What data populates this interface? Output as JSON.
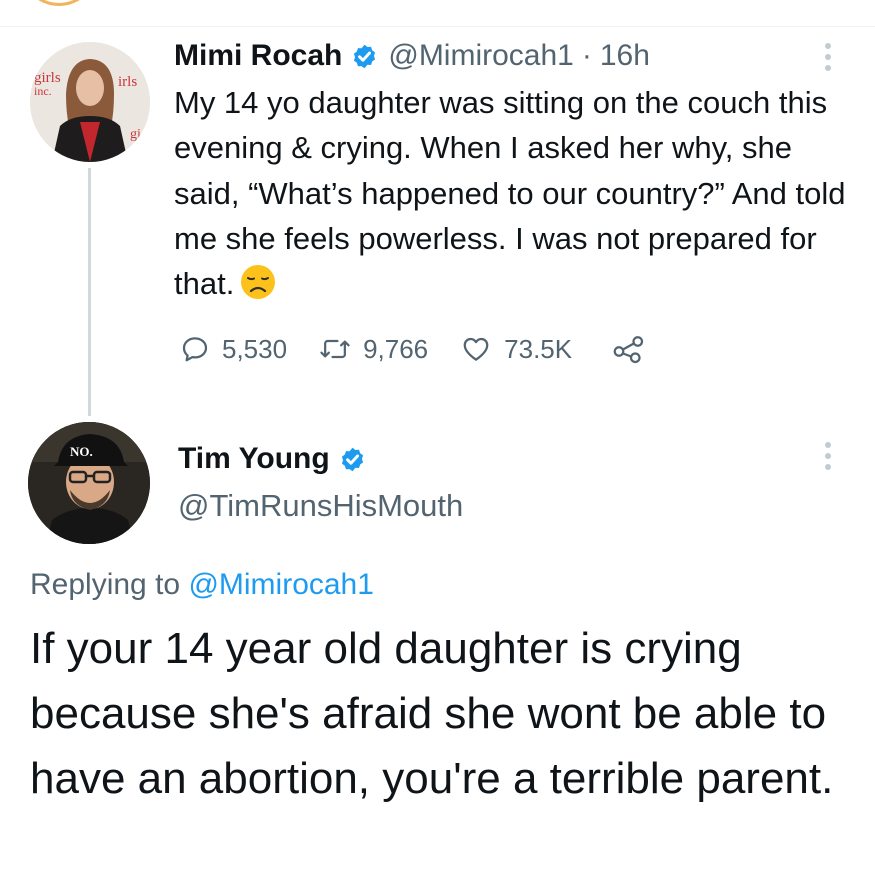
{
  "tweet1": {
    "display_name": "Mimi Rocah",
    "handle": "@Mimirocah1",
    "separator": "·",
    "time": "16h",
    "text": "My 14 yo daughter was sitting on the couch this evening & crying. When I asked her why, she said, “What’s happened to our country?” And told me she feels powerless. I was not prepared for that.",
    "emoji": "disappointed-face",
    "stats": {
      "replies": "5,530",
      "retweets": "9,766",
      "likes": "73.5K"
    }
  },
  "tweet2": {
    "display_name": "Tim Young",
    "handle": "@TimRunsHisMouth",
    "replying_prefix": "Replying to",
    "replying_to": "@Mimirocah1",
    "text": "If your 14 year old daughter is crying because she's afraid she wont be able to have an abortion, you're a terrible parent."
  },
  "avatar_backdrop_text": {
    "left": "girls",
    "left2": "inc.",
    "right": "irls",
    "right2": "gi"
  },
  "avatar_hat_text": "NO.",
  "colors": {
    "verified": "#1d9bf0",
    "muted": "#536471",
    "link": "#1d9bf0",
    "thread_line": "#cfd9de",
    "emoji": "#fcc21b"
  }
}
